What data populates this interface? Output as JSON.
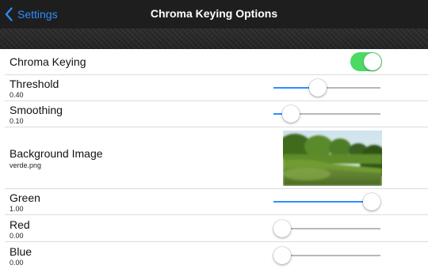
{
  "navbar": {
    "back_label": "Settings",
    "title": "Chroma Keying Options"
  },
  "rows": {
    "chroma_keying": {
      "label": "Chroma Keying",
      "enabled": true
    },
    "threshold": {
      "label": "Threshold",
      "value_text": "0.40",
      "value": 0.4
    },
    "smoothing": {
      "label": "Smoothing",
      "value_text": "0.10",
      "value": 0.1
    },
    "background_image": {
      "label": "Background Image",
      "filename": "verde.png"
    },
    "green": {
      "label": "Green",
      "value_text": "1.00",
      "value": 1.0
    },
    "red": {
      "label": "Red",
      "value_text": "0.00",
      "value": 0.0
    },
    "blue": {
      "label": "Blue",
      "value_text": "0.00",
      "value": 0.0
    }
  },
  "colors": {
    "accent": "#2f8cff",
    "toggle_on": "#4cd964",
    "navbar_bg": "#1e1e1e"
  }
}
